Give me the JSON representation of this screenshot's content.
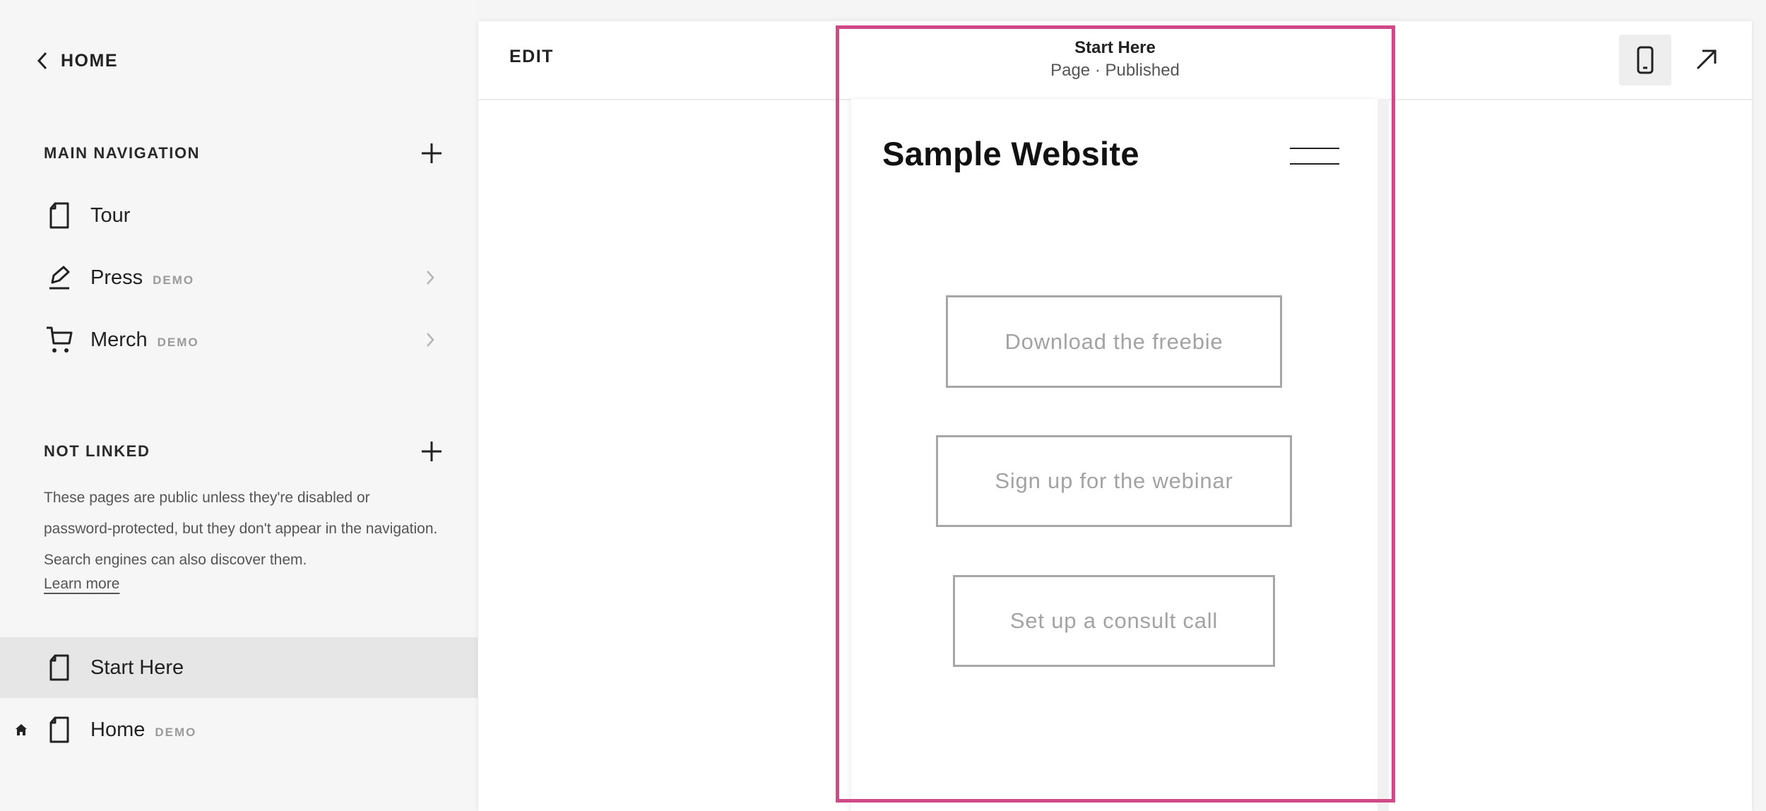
{
  "sidebar": {
    "back_label": "HOME",
    "main_nav_title": "MAIN NAVIGATION",
    "main_nav_items": [
      {
        "label": "Tour",
        "tag": ""
      },
      {
        "label": "Press",
        "tag": "DEMO"
      },
      {
        "label": "Merch",
        "tag": "DEMO"
      }
    ],
    "not_linked_title": "NOT LINKED",
    "not_linked_description": "These pages are public unless they're disabled or password-protected, but they don't appear in the navigation. Search engines can also discover them.",
    "learn_more": "Learn more",
    "not_linked_items": [
      {
        "label": "Start Here",
        "tag": "",
        "selected": true
      },
      {
        "label": "Home",
        "tag": "DEMO",
        "is_homepage": true
      }
    ]
  },
  "topbar": {
    "edit_label": "EDIT",
    "page_title": "Start Here",
    "page_status": "Page · Published"
  },
  "preview": {
    "site_title": "Sample Website",
    "buttons": [
      "Download the freebie",
      "Sign up for the webinar",
      "Set up a consult call"
    ]
  },
  "colors": {
    "highlight": "#cf4a87",
    "sidebar_bg": "#f6f6f6",
    "selected_bg": "#e6e6e6",
    "button_border": "#a7a7a7",
    "button_text": "#a3a3a3"
  },
  "icons": [
    "chevron-left-icon",
    "plus-icon",
    "page-icon",
    "press-pen-icon",
    "cart-icon",
    "chevron-right-icon",
    "home-icon",
    "mobile-device-icon",
    "arrow-up-right-icon",
    "hamburger-menu-icon"
  ]
}
